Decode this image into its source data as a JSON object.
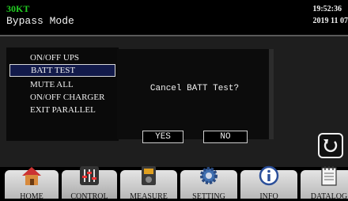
{
  "header": {
    "model": "30KT",
    "mode": "Bypass Mode",
    "time": "19:52:36",
    "date": "2019 11 07"
  },
  "menu": {
    "items": [
      "ON/OFF UPS",
      "BATT TEST",
      "MUTE ALL",
      "ON/OFF CHARGER",
      "EXIT PARALLEL"
    ],
    "selected_index": 1
  },
  "dialog": {
    "message": "Cancel BATT Test?",
    "yes_label": "YES",
    "no_label": "NO"
  },
  "back_icon": "refresh-back-icon",
  "tabs": [
    {
      "label": "HOME",
      "icon": "house-icon"
    },
    {
      "label": "CONTROL",
      "icon": "sliders-icon"
    },
    {
      "label": "MEASURE",
      "icon": "meter-icon"
    },
    {
      "label": "SETTING",
      "icon": "gear-icon"
    },
    {
      "label": "INFO",
      "icon": "info-icon"
    },
    {
      "label": "DATALOG",
      "icon": "notebook-icon"
    }
  ],
  "colors": {
    "model": "#22cc22",
    "selected_item": "#121a4a",
    "background": "#1e1e1e"
  }
}
